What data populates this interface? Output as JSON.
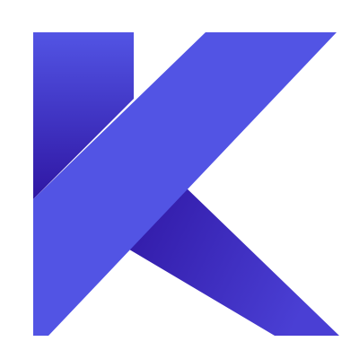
{
  "logo": {
    "icon": "letter-k-logo-icon",
    "colors": {
      "background": "#ffffff",
      "primary": "#5254e4",
      "shade_dark": "#2f16a3",
      "shade_light": "#4a3fd4"
    }
  }
}
